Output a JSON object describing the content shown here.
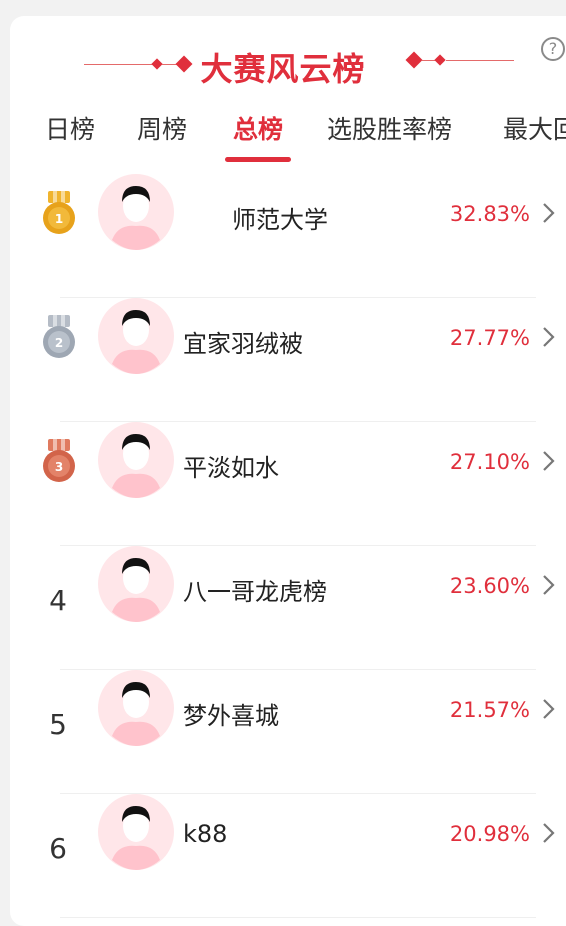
{
  "header": {
    "title": "大赛风云榜",
    "help_label": "?"
  },
  "tabs": [
    {
      "label": "日榜",
      "active": false
    },
    {
      "label": "周榜",
      "active": false
    },
    {
      "label": "总榜",
      "active": true
    },
    {
      "label": "选股胜率榜",
      "active": false
    },
    {
      "label": "最大回",
      "active": false
    }
  ],
  "ranking": [
    {
      "rank": "1",
      "medal": "gold-medal-icon",
      "name": "师范大学",
      "rate": "32.83%"
    },
    {
      "rank": "2",
      "medal": "silver-medal-icon",
      "name": "宜家羽绒被",
      "rate": "27.77%"
    },
    {
      "rank": "3",
      "medal": "bronze-medal-icon",
      "name": "平淡如水",
      "rate": "27.10%"
    },
    {
      "rank": "4",
      "medal": "",
      "name": "八一哥龙虎榜",
      "rate": "23.60%"
    },
    {
      "rank": "5",
      "medal": "",
      "name": "梦外喜城",
      "rate": "21.57%"
    },
    {
      "rank": "6",
      "medal": "",
      "name": "k88",
      "rate": "20.98%"
    }
  ],
  "colors": {
    "accent": "#e02f3c",
    "gold": "#e7a21b",
    "silver": "#9ea7b3",
    "bronze": "#d2644a",
    "avatar_bg": "#ffe6e9"
  },
  "icons": {
    "avatar": "default-avatar-icon",
    "chevron": "chevron-right-icon",
    "help": "help-circle-icon"
  }
}
